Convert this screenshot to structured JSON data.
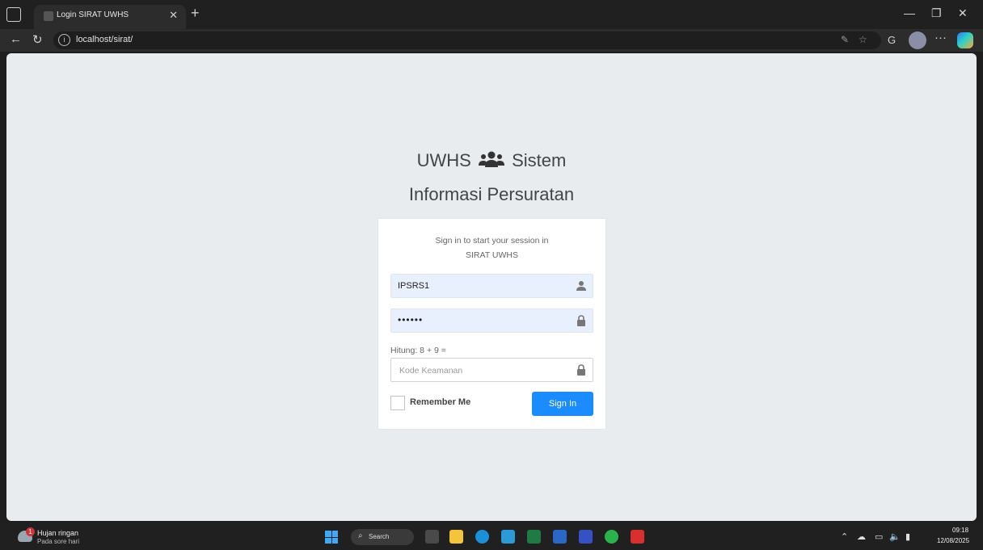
{
  "browser": {
    "tab_title": "Login SIRAT UWHS",
    "url": "localhost/sirat/"
  },
  "logo": {
    "line1_left": "UWHS",
    "line1_right": "Sistem",
    "line2": "Informasi Persuratan",
    "icon": "users-icon"
  },
  "login": {
    "message_line1": "Sign in to start your session in",
    "message_line2": "SIRAT UWHS",
    "username_value": "IPSRS1",
    "password_value": "••••••",
    "captcha_label": "Hitung: 8 + 9 =",
    "captcha_placeholder": "Kode Keamanan",
    "remember_label": "Remember Me",
    "signin_label": "Sign In"
  },
  "taskbar": {
    "weather_title": "Hujan ringan",
    "weather_sub": "Pada sore hari",
    "weather_badge": "1",
    "search_label": "Search",
    "time": "09:18",
    "date": "12/08/2025"
  }
}
